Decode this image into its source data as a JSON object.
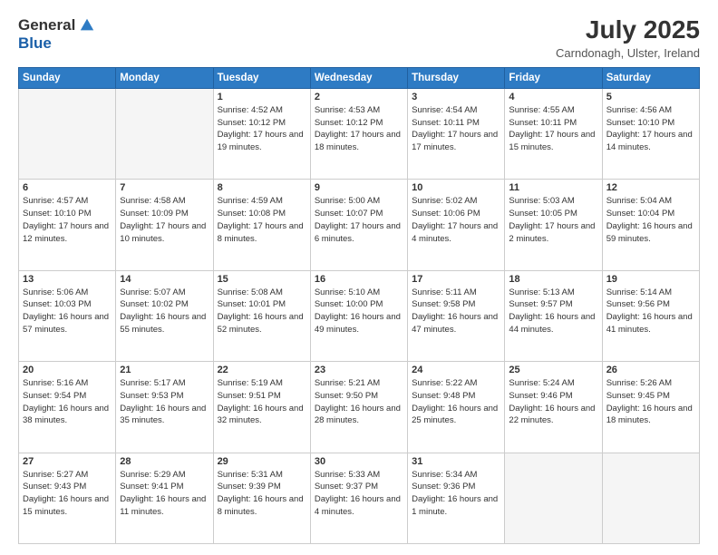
{
  "logo": {
    "general": "General",
    "blue": "Blue"
  },
  "title": "July 2025",
  "location": "Carndonagh, Ulster, Ireland",
  "days_of_week": [
    "Sunday",
    "Monday",
    "Tuesday",
    "Wednesday",
    "Thursday",
    "Friday",
    "Saturday"
  ],
  "weeks": [
    [
      {
        "day": "",
        "empty": true
      },
      {
        "day": "",
        "empty": true
      },
      {
        "day": "1",
        "sunrise": "4:52 AM",
        "sunset": "10:12 PM",
        "daylight": "17 hours and 19 minutes."
      },
      {
        "day": "2",
        "sunrise": "4:53 AM",
        "sunset": "10:12 PM",
        "daylight": "17 hours and 18 minutes."
      },
      {
        "day": "3",
        "sunrise": "4:54 AM",
        "sunset": "10:11 PM",
        "daylight": "17 hours and 17 minutes."
      },
      {
        "day": "4",
        "sunrise": "4:55 AM",
        "sunset": "10:11 PM",
        "daylight": "17 hours and 15 minutes."
      },
      {
        "day": "5",
        "sunrise": "4:56 AM",
        "sunset": "10:10 PM",
        "daylight": "17 hours and 14 minutes."
      }
    ],
    [
      {
        "day": "6",
        "sunrise": "4:57 AM",
        "sunset": "10:10 PM",
        "daylight": "17 hours and 12 minutes."
      },
      {
        "day": "7",
        "sunrise": "4:58 AM",
        "sunset": "10:09 PM",
        "daylight": "17 hours and 10 minutes."
      },
      {
        "day": "8",
        "sunrise": "4:59 AM",
        "sunset": "10:08 PM",
        "daylight": "17 hours and 8 minutes."
      },
      {
        "day": "9",
        "sunrise": "5:00 AM",
        "sunset": "10:07 PM",
        "daylight": "17 hours and 6 minutes."
      },
      {
        "day": "10",
        "sunrise": "5:02 AM",
        "sunset": "10:06 PM",
        "daylight": "17 hours and 4 minutes."
      },
      {
        "day": "11",
        "sunrise": "5:03 AM",
        "sunset": "10:05 PM",
        "daylight": "17 hours and 2 minutes."
      },
      {
        "day": "12",
        "sunrise": "5:04 AM",
        "sunset": "10:04 PM",
        "daylight": "16 hours and 59 minutes."
      }
    ],
    [
      {
        "day": "13",
        "sunrise": "5:06 AM",
        "sunset": "10:03 PM",
        "daylight": "16 hours and 57 minutes."
      },
      {
        "day": "14",
        "sunrise": "5:07 AM",
        "sunset": "10:02 PM",
        "daylight": "16 hours and 55 minutes."
      },
      {
        "day": "15",
        "sunrise": "5:08 AM",
        "sunset": "10:01 PM",
        "daylight": "16 hours and 52 minutes."
      },
      {
        "day": "16",
        "sunrise": "5:10 AM",
        "sunset": "10:00 PM",
        "daylight": "16 hours and 49 minutes."
      },
      {
        "day": "17",
        "sunrise": "5:11 AM",
        "sunset": "9:58 PM",
        "daylight": "16 hours and 47 minutes."
      },
      {
        "day": "18",
        "sunrise": "5:13 AM",
        "sunset": "9:57 PM",
        "daylight": "16 hours and 44 minutes."
      },
      {
        "day": "19",
        "sunrise": "5:14 AM",
        "sunset": "9:56 PM",
        "daylight": "16 hours and 41 minutes."
      }
    ],
    [
      {
        "day": "20",
        "sunrise": "5:16 AM",
        "sunset": "9:54 PM",
        "daylight": "16 hours and 38 minutes."
      },
      {
        "day": "21",
        "sunrise": "5:17 AM",
        "sunset": "9:53 PM",
        "daylight": "16 hours and 35 minutes."
      },
      {
        "day": "22",
        "sunrise": "5:19 AM",
        "sunset": "9:51 PM",
        "daylight": "16 hours and 32 minutes."
      },
      {
        "day": "23",
        "sunrise": "5:21 AM",
        "sunset": "9:50 PM",
        "daylight": "16 hours and 28 minutes."
      },
      {
        "day": "24",
        "sunrise": "5:22 AM",
        "sunset": "9:48 PM",
        "daylight": "16 hours and 25 minutes."
      },
      {
        "day": "25",
        "sunrise": "5:24 AM",
        "sunset": "9:46 PM",
        "daylight": "16 hours and 22 minutes."
      },
      {
        "day": "26",
        "sunrise": "5:26 AM",
        "sunset": "9:45 PM",
        "daylight": "16 hours and 18 minutes."
      }
    ],
    [
      {
        "day": "27",
        "sunrise": "5:27 AM",
        "sunset": "9:43 PM",
        "daylight": "16 hours and 15 minutes."
      },
      {
        "day": "28",
        "sunrise": "5:29 AM",
        "sunset": "9:41 PM",
        "daylight": "16 hours and 11 minutes."
      },
      {
        "day": "29",
        "sunrise": "5:31 AM",
        "sunset": "9:39 PM",
        "daylight": "16 hours and 8 minutes."
      },
      {
        "day": "30",
        "sunrise": "5:33 AM",
        "sunset": "9:37 PM",
        "daylight": "16 hours and 4 minutes."
      },
      {
        "day": "31",
        "sunrise": "5:34 AM",
        "sunset": "9:36 PM",
        "daylight": "16 hours and 1 minute."
      },
      {
        "day": "",
        "empty": true
      },
      {
        "day": "",
        "empty": true
      }
    ]
  ]
}
